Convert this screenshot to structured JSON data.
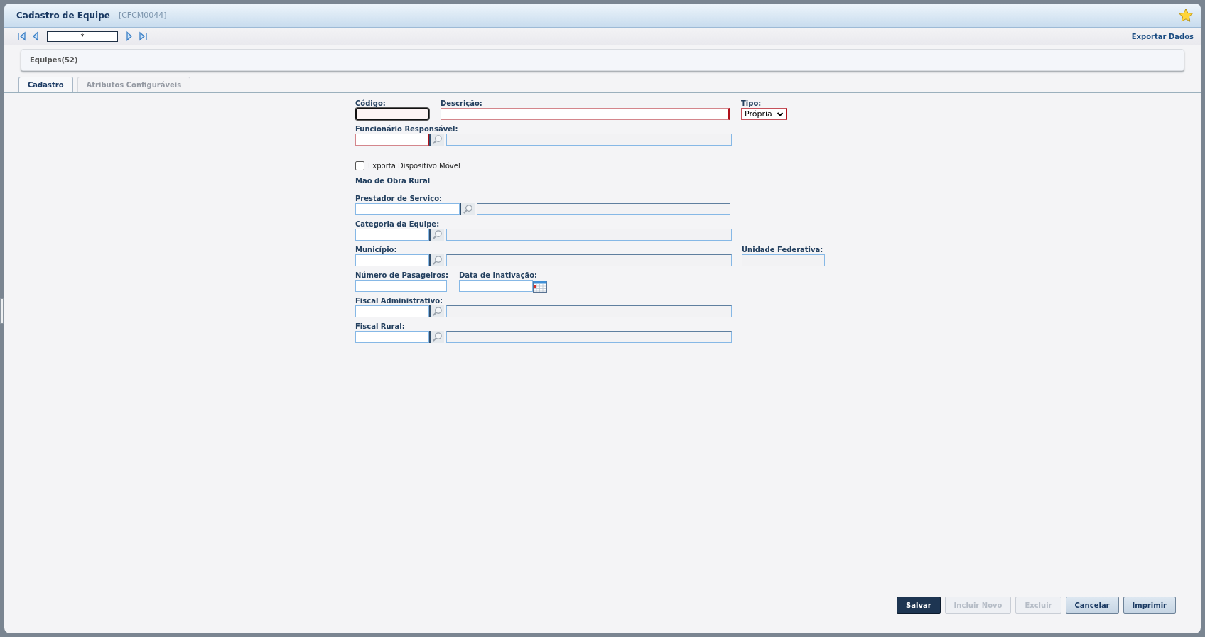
{
  "window": {
    "title": "Cadastro de Equipe",
    "code": "[CFCM0044]"
  },
  "pager": {
    "value": "*"
  },
  "export_link": "Exportar Dados",
  "panel": {
    "title": "Equipes(52)"
  },
  "tabs": [
    {
      "label": "Cadastro",
      "selected": true
    },
    {
      "label": "Atributos Configuráveis",
      "selected": false
    }
  ],
  "form": {
    "rows": [
      {
        "kind": "fields",
        "fields": [
          {
            "label": "Código:",
            "kind": "text",
            "required": true,
            "focused": true
          },
          {
            "label": "Descrição:",
            "kind": "text",
            "required": true
          },
          {
            "label": "Tipo:",
            "kind": "select",
            "required": true,
            "value": "Própria"
          }
        ]
      },
      {
        "kind": "fields",
        "fields": [
          {
            "label": "Funcionário Responsável:",
            "kind": "lookup",
            "required": true
          }
        ]
      },
      {
        "kind": "checkbox",
        "label": "Exporta Dispositivo Móvel",
        "checked": false
      },
      {
        "kind": "section",
        "label": "Mão de Obra Rural"
      },
      {
        "kind": "fields",
        "fields": [
          {
            "label": "Prestador de Serviço:",
            "kind": "lookup",
            "required": false
          }
        ]
      },
      {
        "kind": "fields",
        "fields": [
          {
            "label": "Categoria da Equipe:",
            "kind": "lookup",
            "required": false
          }
        ]
      },
      {
        "kind": "fields",
        "fields": [
          {
            "label": "Município:",
            "kind": "lookup",
            "required": false
          },
          {
            "label": "Unidade Federativa:",
            "kind": "readonly",
            "required": false
          }
        ]
      },
      {
        "kind": "fields",
        "fields": [
          {
            "label": "Número de Pasageiros:",
            "kind": "text",
            "required": false
          },
          {
            "label": "Data de Inativação:",
            "kind": "date",
            "required": false
          }
        ]
      },
      {
        "kind": "fields",
        "fields": [
          {
            "label": "Fiscal Administrativo:",
            "kind": "lookup",
            "required": false
          }
        ]
      },
      {
        "kind": "fields",
        "fields": [
          {
            "label": "Fiscal Rural:",
            "kind": "lookup",
            "required": false
          }
        ]
      }
    ]
  },
  "buttons": [
    {
      "label": "Salvar",
      "kind": "primary",
      "disabled": false
    },
    {
      "label": "Incluir Novo",
      "kind": "normal",
      "disabled": true
    },
    {
      "label": "Excluir",
      "kind": "normal",
      "disabled": true
    },
    {
      "label": "Cancelar",
      "kind": "normal",
      "disabled": false
    },
    {
      "label": "Imprimir",
      "kind": "normal",
      "disabled": false
    }
  ]
}
